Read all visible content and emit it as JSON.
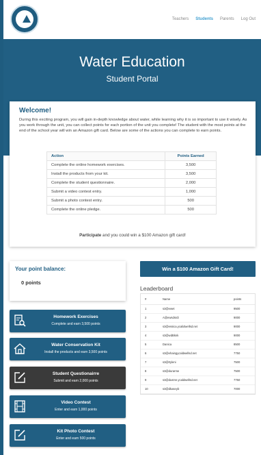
{
  "nav": {
    "items": [
      {
        "label": "Teachers",
        "active": false
      },
      {
        "label": "Students",
        "active": true
      },
      {
        "label": "Parents",
        "active": false
      },
      {
        "label": "Log Out",
        "active": false
      }
    ]
  },
  "hero": {
    "title": "Water Education",
    "subtitle": "Student Portal"
  },
  "welcome": {
    "heading": "Welcome!",
    "intro": "During this exciting program, you will gain in-depth knowledge about water, while learning why it is so important to use it wisely. As you work through the unit, you can collect points for each portion of the unit you complete! The student with the most points at the end of the school year will win an Amazon gift card. Below are some of the actions you can complete to earn points.",
    "table_headers": {
      "action": "Action",
      "points": "Points Earned"
    },
    "actions": [
      {
        "action": "Complete the online homework exercises.",
        "points": "3,500"
      },
      {
        "action": "Install the products from your kit.",
        "points": "3,500"
      },
      {
        "action": "Complete the student questionnaire.",
        "points": "2,000"
      },
      {
        "action": "Submit a video contest entry.",
        "points": "1,000"
      },
      {
        "action": "Submit a photo contest entry.",
        "points": "500"
      },
      {
        "action": "Complete the online pledge.",
        "points": "500"
      }
    ],
    "footer_bold": "Participate",
    "footer_rest": " and you could win a $100 Amazon gift card!"
  },
  "balance": {
    "title": "Your point balance:",
    "value": "0 points"
  },
  "gift_button": "Win a $100 Amazon Gift Card!",
  "action_buttons": [
    {
      "title": "Homework Exercises",
      "sub": "Complete and earn 3,500 points",
      "icon": "search-document-icon",
      "dark": false
    },
    {
      "title": "Water Conservation Kit",
      "sub": "Install the products and earn 3,500 points",
      "icon": "house-icon",
      "dark": false
    },
    {
      "title": "Student Questionairre",
      "sub": "Submit and earn 2,000 points",
      "icon": "edit-icon",
      "dark": true
    },
    {
      "title": "Video Contest",
      "sub": "Enter and earn 1,000 points",
      "icon": "film-icon",
      "dark": false
    },
    {
      "title": "Kit Photo Contest",
      "sub": "Enter and earn 500 points",
      "icon": "edit-icon",
      "dark": false
    }
  ],
  "leaderboard": {
    "title": "Leaderboard",
    "headers": {
      "rank": "#",
      "name": "Name",
      "points": "points"
    },
    "rows": [
      {
        "rank": "1",
        "name": "s3@ewet",
        "points": "9500"
      },
      {
        "rank": "2",
        "name": "A@ewsdsrdi",
        "points": "9000"
      },
      {
        "rank": "3",
        "name": "s3@essica.ycalidwellsd.net",
        "points": "9000"
      },
      {
        "rank": "4",
        "name": "s3@wdBknk",
        "points": "9000"
      },
      {
        "rank": "5",
        "name": "Danica",
        "points": "8500"
      },
      {
        "rank": "6",
        "name": "s3@ehaingycaldwellsd.net",
        "points": "7750"
      },
      {
        "rank": "7",
        "name": "s3@0yleni",
        "points": "7500"
      },
      {
        "rank": "8",
        "name": "s3@durarme",
        "points": "7500"
      },
      {
        "rank": "9",
        "name": "s3@dusmn.ycaldwellsd.net",
        "points": "7750"
      },
      {
        "rank": "10",
        "name": "s3@dkaseyb",
        "points": "7000"
      }
    ]
  },
  "colors": {
    "brand": "#215f83",
    "accent": "#3f9fd0",
    "dark_button": "#3a3a3a"
  }
}
